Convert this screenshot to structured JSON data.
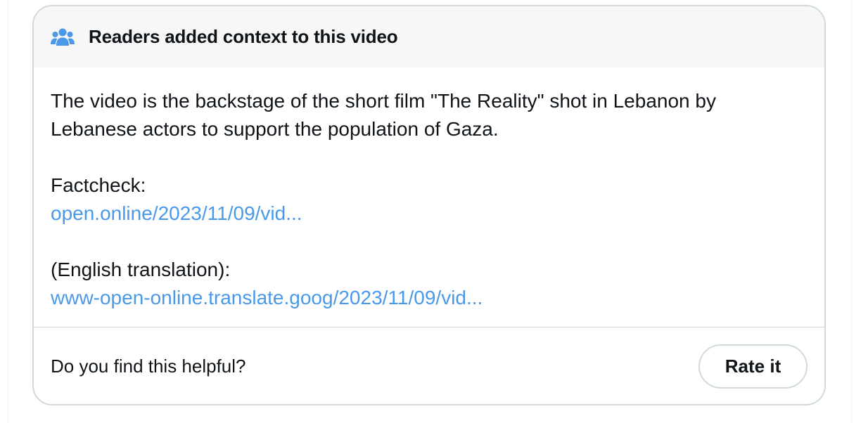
{
  "header": {
    "icon": "people-icon",
    "title": "Readers added context to this video"
  },
  "body": {
    "paragraph1_line1": "The video is the backstage of the short film \"The Reality\" shot in Lebanon by",
    "paragraph1_line2": "Lebanese actors to support the population of Gaza.",
    "factcheck_label": "Factcheck:",
    "factcheck_link": "open.online/2023/11/09/vid...",
    "translation_label": "(English translation):",
    "translation_link": "www-open-online.translate.goog/2023/11/09/vid..."
  },
  "footer": {
    "question": "Do you find this helpful?",
    "rate_label": "Rate it"
  },
  "colors": {
    "link": "#4a99e9",
    "icon": "#4a99e9",
    "header_bg": "#f7f7f7",
    "border": "#cfd9de"
  }
}
